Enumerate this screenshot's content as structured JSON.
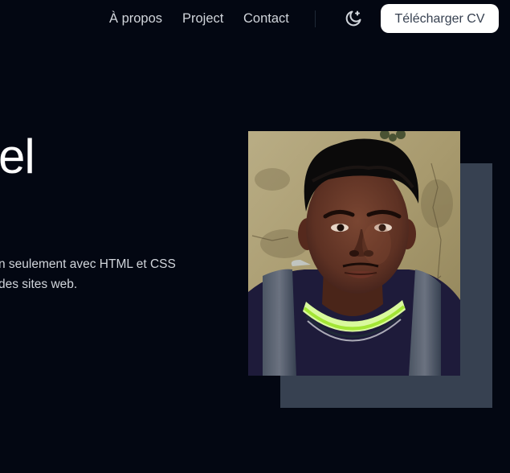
{
  "nav": {
    "links": [
      "À propos",
      "Project",
      "Contact"
    ],
    "theme_toggle_icon": "moon-sparkle-icon",
    "cv_button_label": "Télécharger CV"
  },
  "hero": {
    "name_fragment": "el",
    "description_lines": [
      "n seulement avec HTML et CSS",
      "des sites web."
    ],
    "photo_alt": "Portrait"
  },
  "colors": {
    "background": "#030712",
    "text_primary": "#ffffff",
    "text_secondary": "#d1d5db",
    "button_bg": "#ffffff",
    "photo_backdrop": "#374151"
  }
}
